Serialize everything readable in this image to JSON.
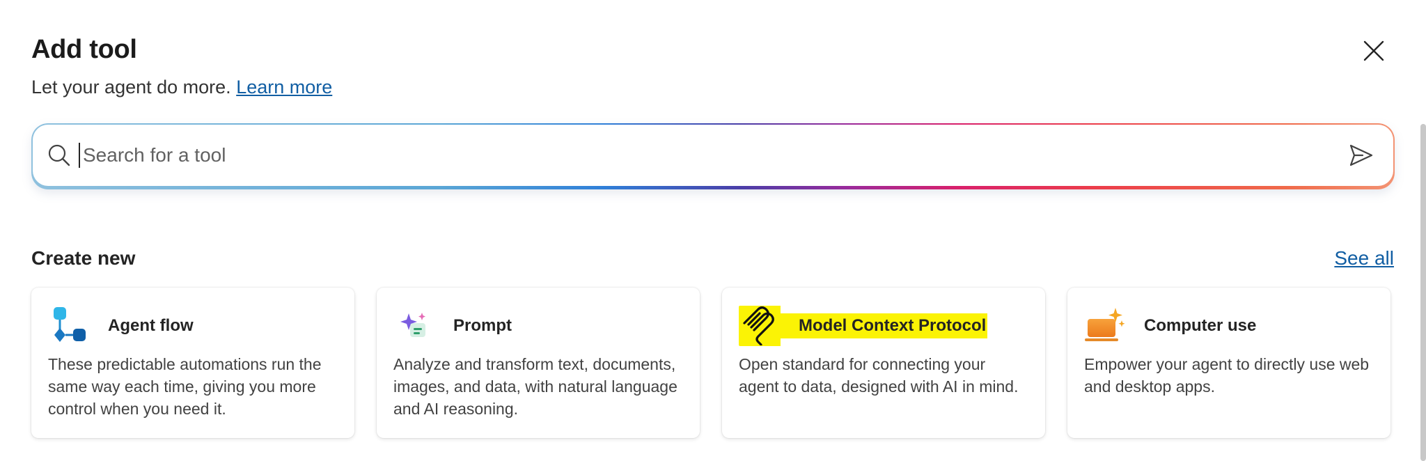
{
  "dialog": {
    "title": "Add tool",
    "subtitle_text": "Let your agent do more.",
    "learn_more": "Learn more",
    "close_label": "Close"
  },
  "search": {
    "placeholder": "Search for a tool",
    "value": ""
  },
  "create_new": {
    "title": "Create new",
    "see_all": "See all",
    "cards": [
      {
        "icon": "agent-flow-icon",
        "title": "Agent flow",
        "description": "These predictable automations run the same way each time, giving you more control when you need it."
      },
      {
        "icon": "prompt-icon",
        "title": "Prompt",
        "description": "Analyze and transform text, documents, images, and data, with natural language and AI reasoning."
      },
      {
        "icon": "model-context-protocol-icon",
        "title": "Model Context Protocol",
        "highlighted": true,
        "description": "Open standard for connecting your agent to data, designed with AI in mind."
      },
      {
        "icon": "computer-use-icon",
        "title": "Computer use",
        "description": "Empower your agent to directly use web and desktop apps."
      }
    ]
  },
  "colors": {
    "link": "#115ea3",
    "highlight": "#fbf305",
    "text": "#242424"
  }
}
